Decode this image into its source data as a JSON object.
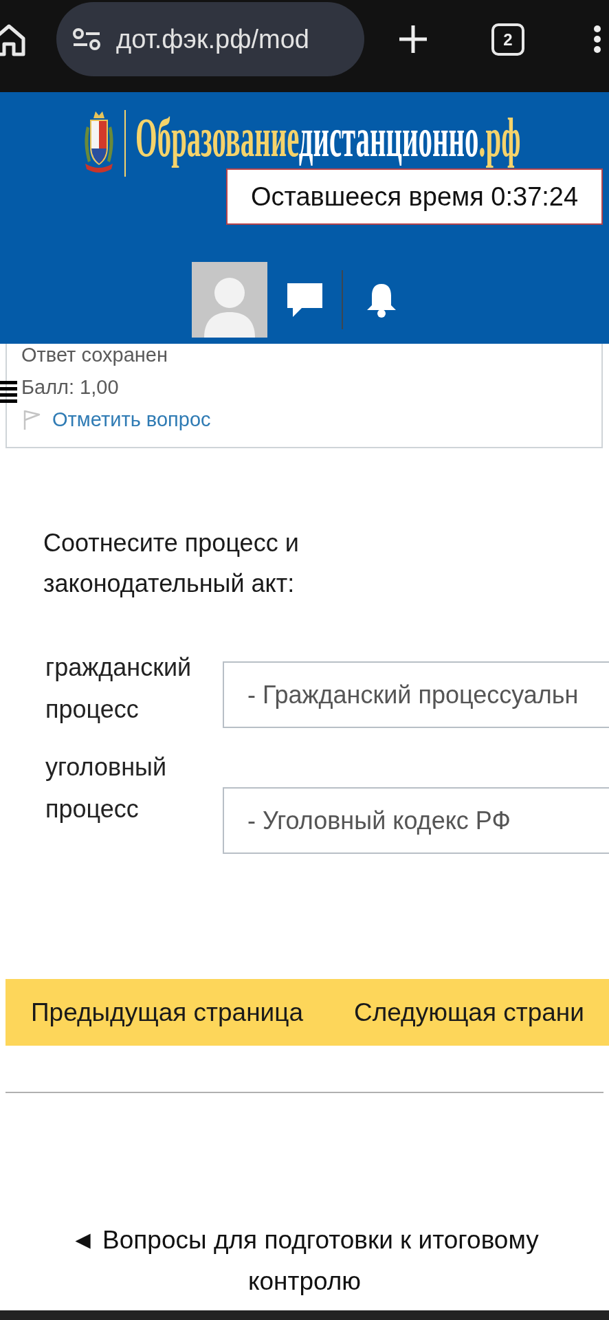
{
  "browser": {
    "url": "дот.фэк.рф/mod",
    "tab_count": "2"
  },
  "header": {
    "logo_parts": [
      {
        "text": "Образование",
        "color": "#f5d36b"
      },
      {
        "text": "дистанционно",
        "color": "#ffffff"
      },
      {
        "text": ".рф",
        "color": "#f5d36b"
      }
    ],
    "timer": "Оставшееся время 0:37:24"
  },
  "question_info": {
    "status": "Ответ сохранен",
    "grade": "Балл: 1,00",
    "flag_link": "Отметить вопрос",
    "flagged": false
  },
  "question": {
    "text": "Соотнесите процесс и законодательный акт:",
    "matches": [
      {
        "label": "гражданский процесс",
        "answer": "- Гражданский процессуальн"
      },
      {
        "label": "уголовный процесс",
        "answer": "- Уголовный кодекс РФ"
      }
    ]
  },
  "navigation": {
    "buttons": [
      "Предыдущая страница",
      "Следующая страни"
    ]
  },
  "footer": {
    "link": "◄ Вопросы для подготовки к итоговому контролю"
  }
}
